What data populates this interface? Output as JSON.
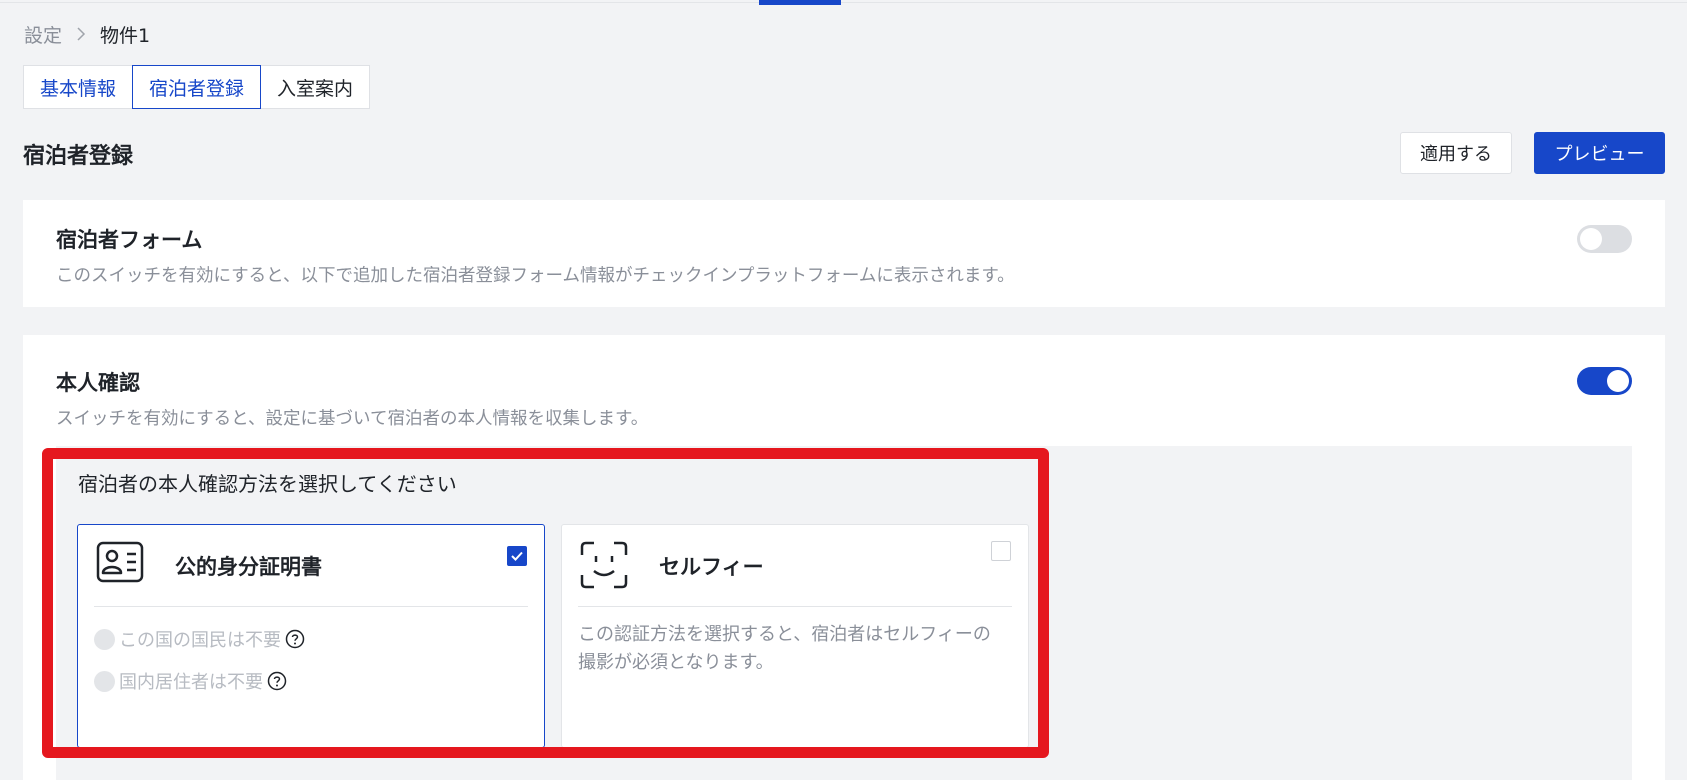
{
  "breadcrumb": {
    "root": "設定",
    "current": "物件1"
  },
  "tabs": [
    {
      "label": "基本情報"
    },
    {
      "label": "宿泊者登録"
    },
    {
      "label": "入室案内"
    }
  ],
  "page": {
    "title": "宿泊者登録"
  },
  "actions": {
    "apply_label": "適用する",
    "preview_label": "プレビュー"
  },
  "guest_form": {
    "title": "宿泊者フォーム",
    "description": "このスイッチを有効にすると、以下で追加した宿泊者登録フォーム情報がチェックインプラットフォームに表示されます。",
    "enabled": false
  },
  "identity_check": {
    "title": "本人確認",
    "description": "スイッチを有効にすると、設定に基づいて宿泊者の本人情報を収集します。",
    "enabled": true,
    "method_prompt": "宿泊者の本人確認方法を選択してください",
    "options": [
      {
        "icon": "id-card-icon",
        "title": "公的身分証明書",
        "checked": true,
        "sub_options": [
          {
            "label": "この国の国民は不要"
          },
          {
            "label": "国内居住者は不要"
          }
        ]
      },
      {
        "icon": "face-scan-icon",
        "title": "セルフィー",
        "checked": false,
        "description": "この認証方法を選択すると、宿泊者はセルフィーの撮影が必須となります。"
      }
    ]
  },
  "colors": {
    "accent": "#1747c9",
    "highlight": "#e5171e",
    "background": "#f2f3f5"
  }
}
